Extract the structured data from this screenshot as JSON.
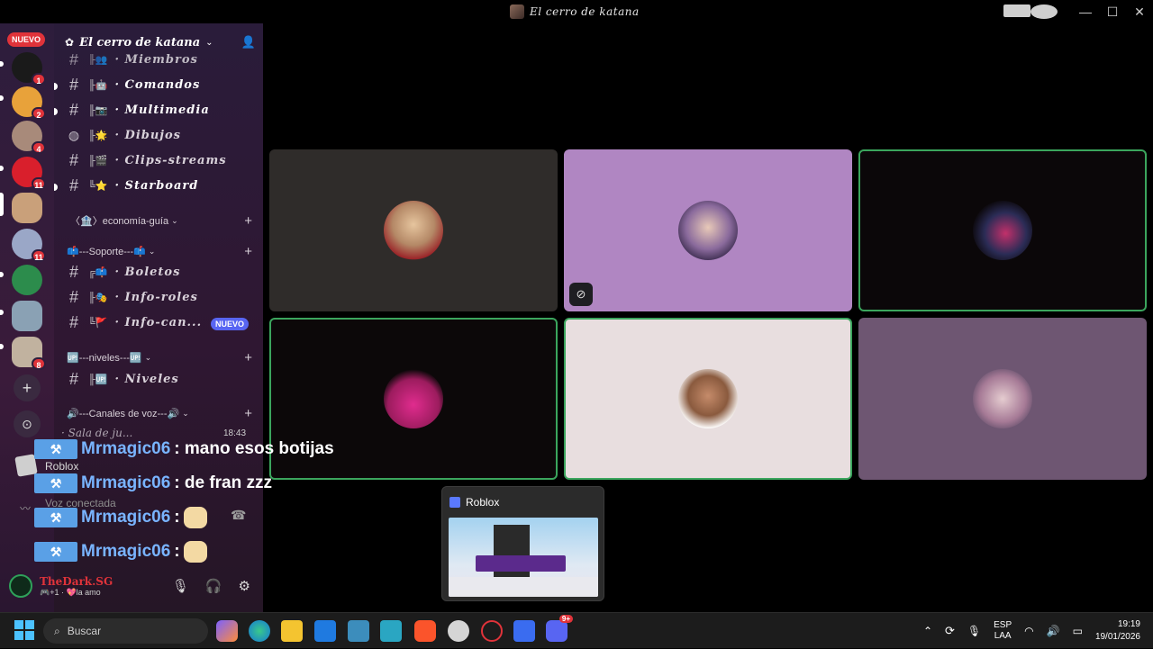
{
  "window": {
    "title": "El cerro de katana"
  },
  "rail": {
    "new_label": "NUEVO",
    "guilds": [
      {
        "badge": "1",
        "color": "#1a1a1a"
      },
      {
        "badge": "2",
        "color": "#e8a23a"
      },
      {
        "badge": "4",
        "color": "#a88a7a"
      },
      {
        "badge": "11",
        "color": "#d91f2c"
      },
      {
        "badge": "",
        "color": "#c9a07a"
      },
      {
        "badge": "11",
        "color": "#9aa7c7"
      },
      {
        "badge": "",
        "color": "#2c8c4c"
      },
      {
        "badge": "",
        "color": "#8aa1b4"
      },
      {
        "badge": "8",
        "color": "#c1b29f"
      }
    ]
  },
  "sidebar": {
    "server_name": "El cerro de katana",
    "channels": [
      {
        "name": "· Miembros",
        "emoji": "╟👥"
      },
      {
        "name": "· Comandos",
        "emoji": "╟🤖"
      },
      {
        "name": "· Multimedia",
        "emoji": "╟📷"
      },
      {
        "name": "· Dibujos",
        "emoji": "╟🌟"
      },
      {
        "name": "· Clips-streams",
        "emoji": "╟🎬"
      },
      {
        "name": "· Starboard",
        "emoji": "╚⭐"
      }
    ],
    "categories": {
      "economia": "〈🏦〉economía-guía",
      "soporte": "📫---Soporte---📫",
      "niveles": "🆙---niveles---🆙",
      "voz": "🔊---Canales de voz---🔊"
    },
    "soporte_channels": [
      {
        "name": "· Boletos",
        "emoji": "╔📫"
      },
      {
        "name": "· Info-roles",
        "emoji": "╟🎭"
      },
      {
        "name": "· Info-can...",
        "emoji": "╚🚩",
        "badge": "NUEVO"
      }
    ],
    "niveles_channels": [
      {
        "name": "· Niveles",
        "emoji": "╟🆙"
      }
    ],
    "voice_channel": {
      "name": "· Sala de ju...",
      "time": "18:43"
    },
    "activity": {
      "app": "Roblox"
    },
    "voice_status": "Voz conectada",
    "user": {
      "name": "TheDark.SG",
      "status": "🎮+1 · 💖la amo"
    }
  },
  "chat_overlay": [
    {
      "user": "Mrmagic06",
      "msg": ": mano esos botijas"
    },
    {
      "user": "Mrmagic06",
      "msg": ": de fran zzz"
    },
    {
      "user": "Mrmagic06",
      "msg": ":"
    },
    {
      "user": "Mrmagic06",
      "msg": ":"
    }
  ],
  "preview": {
    "title": "Roblox"
  },
  "taskbar": {
    "search_placeholder": "Buscar",
    "lang_top": "ESP",
    "lang_bottom": "LAA",
    "time": "19:19",
    "date": "19/01/2026",
    "discord_badge": "9+"
  },
  "colors": {
    "speaking": "#3ba55d",
    "badge_red": "#e0333a",
    "nuevo_blue": "#5865f2"
  }
}
